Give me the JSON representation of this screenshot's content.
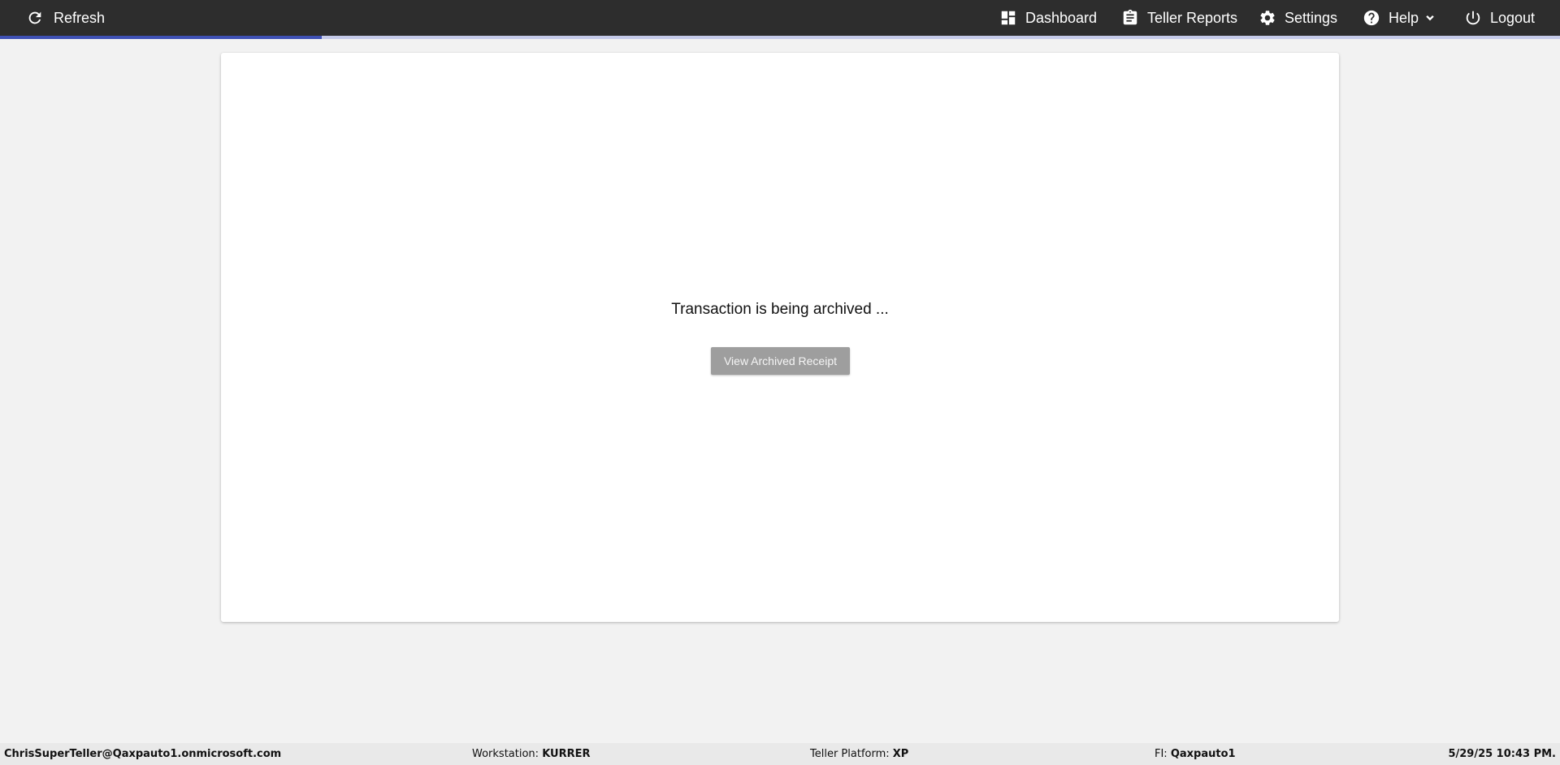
{
  "topbar": {
    "refresh_label": "Refresh",
    "nav": {
      "dashboard": "Dashboard",
      "teller_reports": "Teller Reports",
      "settings": "Settings",
      "help": "Help",
      "logout": "Logout"
    },
    "icons": {
      "refresh": "refresh-icon",
      "dashboard": "dashboard-icon",
      "teller_reports": "clipboard-icon",
      "settings": "gear-icon",
      "help": "help-circle-icon",
      "help_menu": "chevron-down-icon",
      "logout": "power-icon"
    }
  },
  "progress": {
    "fraction": 0.206,
    "fill_color": "#3f51b5",
    "track_color": "#c5cae9"
  },
  "main": {
    "status_message": "Transaction is being archived ...",
    "view_receipt_label": "View Archived Receipt"
  },
  "footer": {
    "user": "ChrisSuperTeller@Qaxpauto1.onmicrosoft.com",
    "workstation_label": "Workstation:",
    "workstation_value": "KURRER",
    "platform_label": "Teller Platform:",
    "platform_value": "XP",
    "fi_label": "FI:",
    "fi_value": "Qaxpauto1",
    "datetime": "5/29/25 10:43 PM."
  },
  "colors": {
    "topbar": "#2d2d2d",
    "button_disabled": "#9e9e9e",
    "background": "#f2f2f2"
  }
}
